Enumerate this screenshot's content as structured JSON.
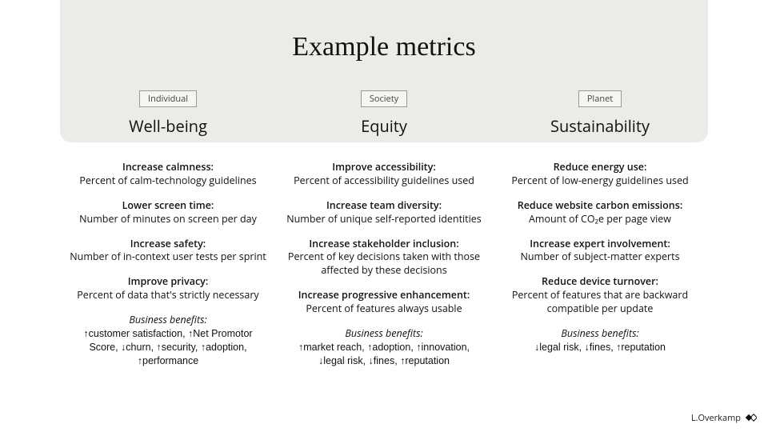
{
  "title": "Example metrics",
  "columns": [
    {
      "tag": "Individual",
      "heading": "Well-being",
      "metrics": [
        {
          "title": "Increase calmness:",
          "desc": "Percent of calm-technology guidelines"
        },
        {
          "title": "Lower screen time:",
          "desc": "Number of minutes on screen per day"
        },
        {
          "title": "Increase safety:",
          "desc": "Number of in-context user tests per sprint"
        },
        {
          "title": "Improve privacy:",
          "desc": "Percent of data that's strictly necessary"
        }
      ],
      "benefits_label": "Business benefits:",
      "benefits_text": "↑customer satisfaction, ↑Net Promotor Score, ↓churn, ↑security, ↑adoption, ↑performance"
    },
    {
      "tag": "Society",
      "heading": "Equity",
      "metrics": [
        {
          "title": "Improve accessibility:",
          "desc": "Percent of accessibility guidelines used"
        },
        {
          "title": "Increase team diversity:",
          "desc": "Number of unique self-reported identities"
        },
        {
          "title": "Increase stakeholder inclusion:",
          "desc": "Percent of key decisions taken with those affected by these decisions"
        },
        {
          "title": "Increase progressive enhancement:",
          "desc": "Percent of features always usable"
        }
      ],
      "benefits_label": "Business benefits:",
      "benefits_text": "↑market reach, ↑adoption, ↑innovation, ↓legal risk, ↓fines, ↑reputation"
    },
    {
      "tag": "Planet",
      "heading": "Sustainability",
      "metrics": [
        {
          "title": "Reduce energy use:",
          "desc": "Percent of low-energy guidelines used"
        },
        {
          "title": "Reduce website carbon emissions:",
          "desc": "Amount of CO₂e per page view"
        },
        {
          "title": "Increase expert involvement:",
          "desc": "Number of subject-matter experts"
        },
        {
          "title": "Reduce device turnover:",
          "desc": "Percent of features that are backward compatible per update"
        }
      ],
      "benefits_label": "Business benefits:",
      "benefits_text": "↓legal risk, ↓fines, ↑reputation"
    }
  ],
  "attribution": "L.Overkamp"
}
